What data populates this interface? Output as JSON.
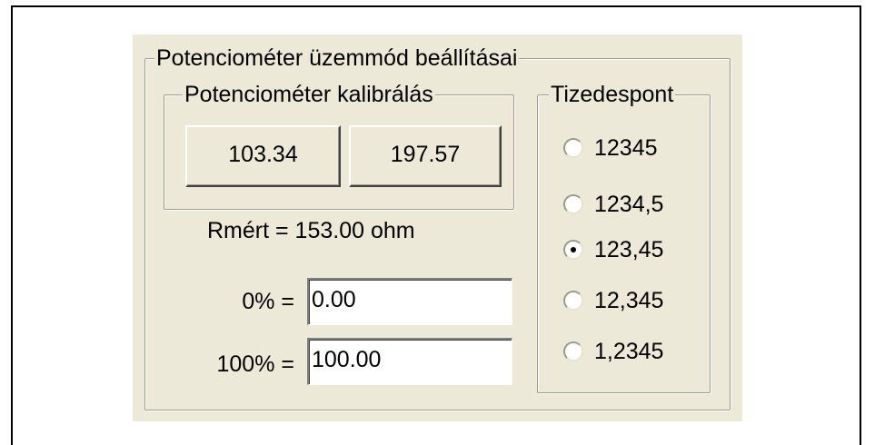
{
  "settings": {
    "title": "Potenciométer üzemmód beállításai"
  },
  "calibration": {
    "title": "Potenciométer kalibrálás",
    "button_low": "103.34",
    "button_high": "197.57",
    "rmert_text": "Rmért = 153.00 ohm"
  },
  "range": {
    "zero_label": "0% =",
    "zero_value": "0.00",
    "hundred_label": "100% =",
    "hundred_value": "100.00"
  },
  "decimal": {
    "title": "Tizedespont",
    "options": [
      {
        "label": "12345",
        "checked": false
      },
      {
        "label": "1234,5",
        "checked": false
      },
      {
        "label": "123,45",
        "checked": true
      },
      {
        "label": "12,345",
        "checked": false
      },
      {
        "label": "1,2345",
        "checked": false
      }
    ]
  }
}
